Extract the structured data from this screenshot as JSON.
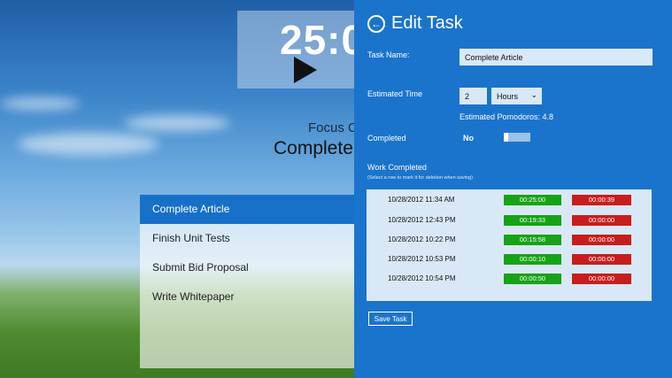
{
  "timer": {
    "display": "25:0",
    "play_icon": "play-icon"
  },
  "focus": {
    "label": "Focus O",
    "task": "Complete"
  },
  "tasks": [
    {
      "label": "Complete Article",
      "selected": true
    },
    {
      "label": "Finish Unit Tests",
      "selected": false
    },
    {
      "label": "Submit Bid Proposal",
      "selected": false
    },
    {
      "label": "Write Whitepaper",
      "selected": false
    }
  ],
  "panel": {
    "title": "Edit Task",
    "back_icon": "back-arrow-icon",
    "task_name_label": "Task Name:",
    "task_name_value": "Complete Article",
    "estimated_time_label": "Estimated Time",
    "estimated_time_value": "2",
    "unit_selected": "Hours",
    "estimated_pomodoros": "Estimated Pomodoros: 4.8",
    "completed_label": "Completed",
    "completed_value": "No",
    "work_completed_label": "Work Completed",
    "work_completed_hint": "(Select a row to mark it for deletion when saving)",
    "save_label": "Save Task"
  },
  "work_rows": [
    {
      "date": "10/28/2012 11:34 AM",
      "work": "00:25:00",
      "break": "00:00:39"
    },
    {
      "date": "10/28/2012 12:43 PM",
      "work": "00:19:33",
      "break": "00:00:00"
    },
    {
      "date": "10/28/2012 10:22 PM",
      "work": "00:15:58",
      "break": "00:00:00"
    },
    {
      "date": "10/28/2012 10:53 PM",
      "work": "00:00:10",
      "break": "00:00:00"
    },
    {
      "date": "10/28/2012 10:54 PM",
      "work": "00:00:50",
      "break": "00:00:00"
    }
  ],
  "colors": {
    "panel": "#1a74cc",
    "work": "#16a316",
    "break": "#c81d1d",
    "selected": "#1670c8"
  }
}
